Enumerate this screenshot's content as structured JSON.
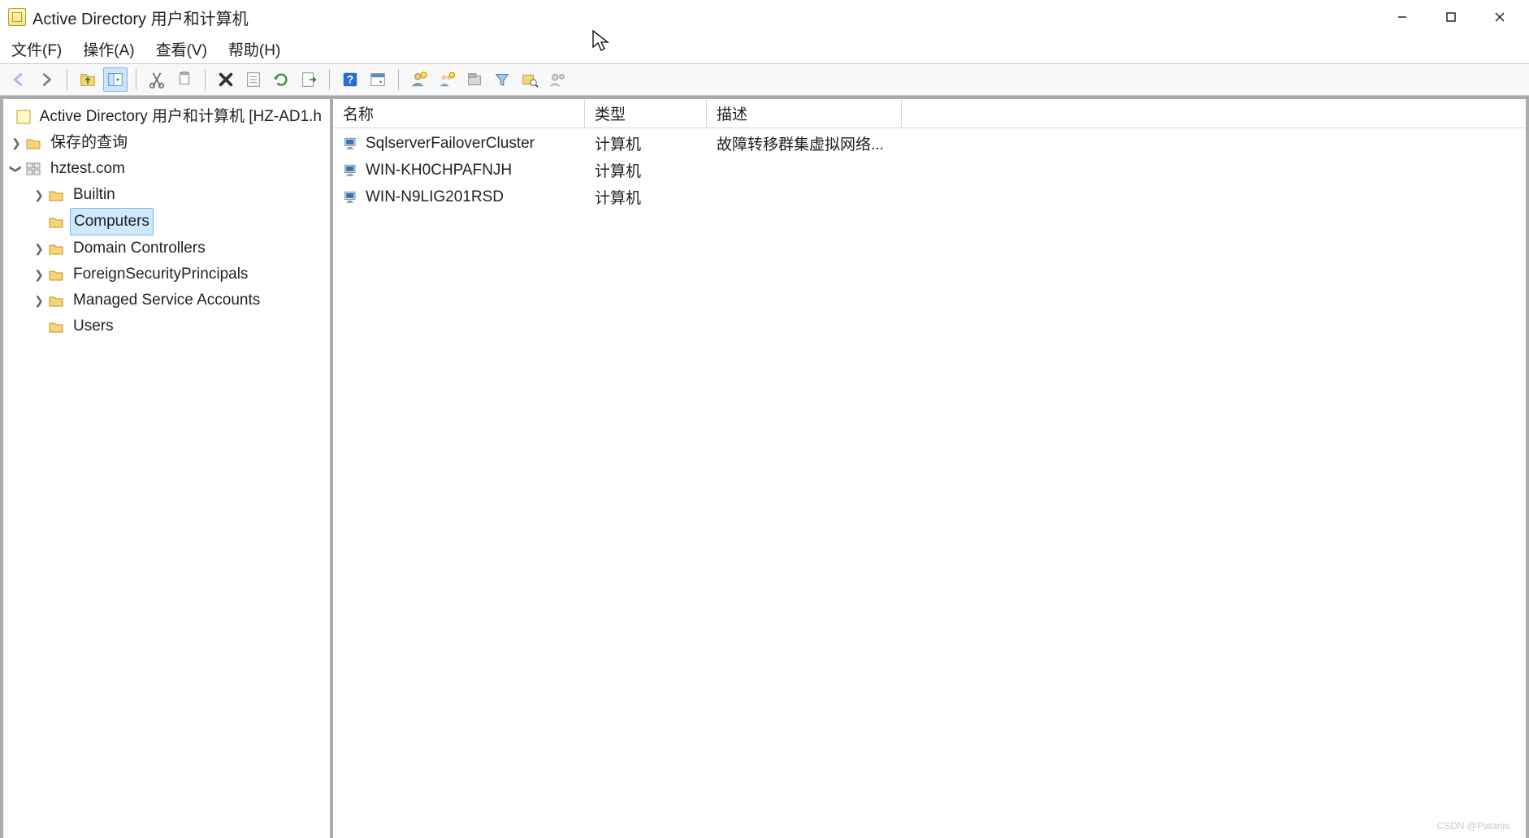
{
  "window": {
    "title": "Active Directory 用户和计算机"
  },
  "menu": {
    "file": "文件(F)",
    "action": "操作(A)",
    "view": "查看(V)",
    "help": "帮助(H)"
  },
  "tree": {
    "root": "Active Directory 用户和计算机 [HZ-AD1.h",
    "savedQueries": "保存的查询",
    "domain": "hztest.com",
    "children": {
      "builtin": "Builtin",
      "computers": "Computers",
      "domainControllers": "Domain Controllers",
      "fsp": "ForeignSecurityPrincipals",
      "msa": "Managed Service Accounts",
      "users": "Users"
    }
  },
  "list": {
    "headers": {
      "name": "名称",
      "type": "类型",
      "desc": "描述"
    },
    "rows": [
      {
        "name": "SqlserverFailoverCluster",
        "type": "计算机",
        "desc": "故障转移群集虚拟网络..."
      },
      {
        "name": "WIN-KH0CHPAFNJH",
        "type": "计算机",
        "desc": ""
      },
      {
        "name": "WIN-N9LIG201RSD",
        "type": "计算机",
        "desc": ""
      }
    ]
  },
  "watermark": "CSDN @Patanis"
}
